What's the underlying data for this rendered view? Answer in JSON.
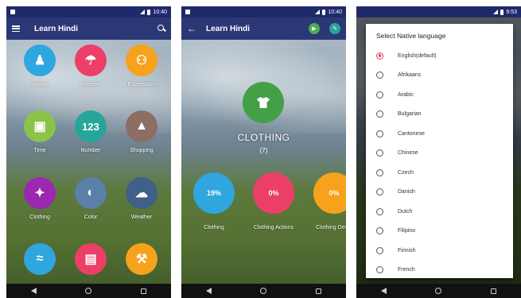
{
  "screen1": {
    "status_time": "10:40",
    "title": "Learn Hindi",
    "categories": [
      {
        "label": "Action",
        "icon": "person-icon",
        "glyph": "♟",
        "color": "#2fa6dd"
      },
      {
        "label": "Adjective",
        "icon": "umbrella-icon",
        "glyph": "☂",
        "color": "#ec3f67"
      },
      {
        "label": "Expression",
        "icon": "people-icon",
        "glyph": "⚇",
        "color": "#f6a21c"
      },
      {
        "label": "Time",
        "icon": "calendar-icon",
        "glyph": "▣",
        "color": "#8bc34a"
      },
      {
        "label": "Number",
        "icon": "numbers-icon",
        "glyph": "123",
        "color": "#26a69a"
      },
      {
        "label": "Shopping",
        "icon": "bag-icon",
        "glyph": "▲",
        "color": "#8d6e63"
      },
      {
        "label": "Clothing",
        "icon": "shirt-icon",
        "glyph": "✦",
        "color": "#9c27b0"
      },
      {
        "label": "Color",
        "icon": "palette-icon",
        "glyph": "◐",
        "color": "#5a7fa8"
      },
      {
        "label": "Weather",
        "icon": "cloud-icon",
        "glyph": "☁",
        "color": "#3f6088"
      },
      {
        "label": "",
        "icon": "dolphin-icon",
        "glyph": "≈",
        "color": "#2fa6dd"
      },
      {
        "label": "",
        "icon": "picture-icon",
        "glyph": "▤",
        "color": "#ec3f67"
      },
      {
        "label": "",
        "icon": "tool-icon",
        "glyph": "⚒",
        "color": "#f6a21c"
      }
    ]
  },
  "screen2": {
    "status_time": "10:40",
    "title": "Learn Hindi",
    "category_name": "CLOTHING",
    "category_count": "(7)",
    "progress": [
      {
        "value": "19%",
        "label": "Clothing",
        "color": "#2fa6dd"
      },
      {
        "value": "0%",
        "label": "Clothing Actions",
        "color": "#ec3f67"
      },
      {
        "value": "0%",
        "label": "Clothing Descr",
        "color": "#f6a21c"
      }
    ]
  },
  "screen3": {
    "status_time": "9:53",
    "dialog_title": "Select Native language",
    "languages": [
      {
        "label": "English(default)",
        "selected": true
      },
      {
        "label": "Afrikaans",
        "selected": false
      },
      {
        "label": "Arabic",
        "selected": false
      },
      {
        "label": "Bulgarian",
        "selected": false
      },
      {
        "label": "Cantonese",
        "selected": false
      },
      {
        "label": "Chinese",
        "selected": false
      },
      {
        "label": "Czech",
        "selected": false
      },
      {
        "label": "Danish",
        "selected": false
      },
      {
        "label": "Dutch",
        "selected": false
      },
      {
        "label": "Filipino",
        "selected": false
      },
      {
        "label": "Finnish",
        "selected": false
      },
      {
        "label": "French",
        "selected": false
      }
    ]
  },
  "colors": {
    "appbar": "#202d6e",
    "hero": "#43a047",
    "accent_green": "#4caf50",
    "accent_teal": "#26a69a",
    "radio_selected": "#e53958"
  }
}
